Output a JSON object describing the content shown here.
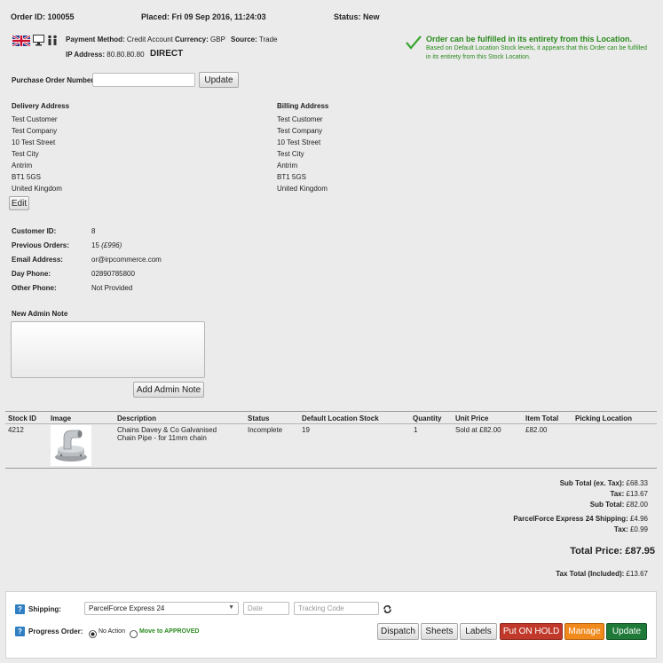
{
  "header": {
    "order_id": "Order ID: 100055",
    "placed": "Placed: Fri 09 Sep 2016, 11:24:03",
    "status": "Status: New"
  },
  "meta": {
    "payment_label": "Payment Method:",
    "payment_value": "Credit Account",
    "currency_label": "Currency:",
    "currency_value": "GBP",
    "source_label": "Source:",
    "source_value": "Trade",
    "ip_label": "IP Address:",
    "ip_value": "80.80.80.80",
    "channel": "DIRECT"
  },
  "fulfil": {
    "title": "Order can be fulfilled in its entirety from this Location.",
    "note": "Based on Default Location Stock levels, it appears that this Order can be fulfilled in its entirety from this Stock Location.",
    "color": "#2a8a1e"
  },
  "po": {
    "label": "Purchase Order Number:",
    "value": "",
    "update_label": "Update"
  },
  "delivery": {
    "title": "Delivery Address",
    "lines": [
      "Test Customer",
      "Test Company",
      "10 Test Street",
      "Test City",
      "Antrim",
      "BT1 5GS",
      "United Kingdom"
    ]
  },
  "billing": {
    "title": "Billing Address",
    "lines": [
      "Test Customer",
      "Test Company",
      "10 Test Street",
      "Test City",
      "Antrim",
      "BT1 5GS",
      "United Kingdom"
    ]
  },
  "edit_label": "Edit",
  "customer": {
    "id_label": "Customer ID:",
    "id_value": "8",
    "prev_label": "Previous Orders:",
    "prev_value": "15",
    "prev_amount": "(£996)",
    "email_label": "Email Address:",
    "email_value": "or@irpcommerce.com",
    "day_label": "Day Phone:",
    "day_value": "02890785800",
    "other_label": "Other Phone:",
    "other_value": "Not Provided"
  },
  "admin_note": {
    "label": "New Admin Note",
    "value": "",
    "button_label": "Add Admin Note"
  },
  "table": {
    "headers": [
      "Stock ID",
      "Image",
      "Description",
      "Status",
      "Default Location Stock",
      "Quantity",
      "Unit Price",
      "Item Total",
      "Picking Location"
    ],
    "rows": [
      {
        "stock_id": "4212",
        "image": "pipe-fitting-image",
        "description": "Chains Davey & Co Galvanised Chain Pipe - for 11mm chain",
        "status": "Incomplete",
        "location_stock": "19",
        "quantity": "1",
        "unit_price": "Sold at £82.00",
        "item_total": "£82.00",
        "picking_location": ""
      }
    ]
  },
  "totals": {
    "subtotal_ex_tax": "Sub Total (ex. Tax):",
    "subtotal_ex_tax_value": "£68.33",
    "tax_label": "Tax:",
    "tax_value": "£13.67",
    "subtotal_label": "Sub Total:",
    "subtotal_value": "£82.00",
    "shipping_label": "ParcelForce Express 24 Shipping:",
    "shipping_value": "£4.96",
    "shipping_tax_label": "Tax:",
    "shipping_tax_value": "£0.99",
    "total_label": "Total Price:",
    "total_value": "£87.95",
    "tax_total_label": "Tax Total (Included):",
    "tax_total_value": "£13.67"
  },
  "footer": {
    "shipping_label": "Shipping:",
    "shipping_selected": "ParcelForce Express 24",
    "date_placeholder": "Date",
    "tracking_placeholder": "Tracking Code",
    "progress_label": "Progress Order:",
    "option_no_action": "No Action",
    "option_approved": "Move to APPROVED",
    "help_glyph": "?",
    "buttons": {
      "dispatch": "Dispatch",
      "sheets": "Sheets",
      "labels": "Labels",
      "hold": "Put ON HOLD",
      "manage": "Manage",
      "update": "Update"
    },
    "colors": {
      "hold": "#c0392b",
      "manage": "#f08a1d",
      "update": "#1f7a3a"
    }
  }
}
